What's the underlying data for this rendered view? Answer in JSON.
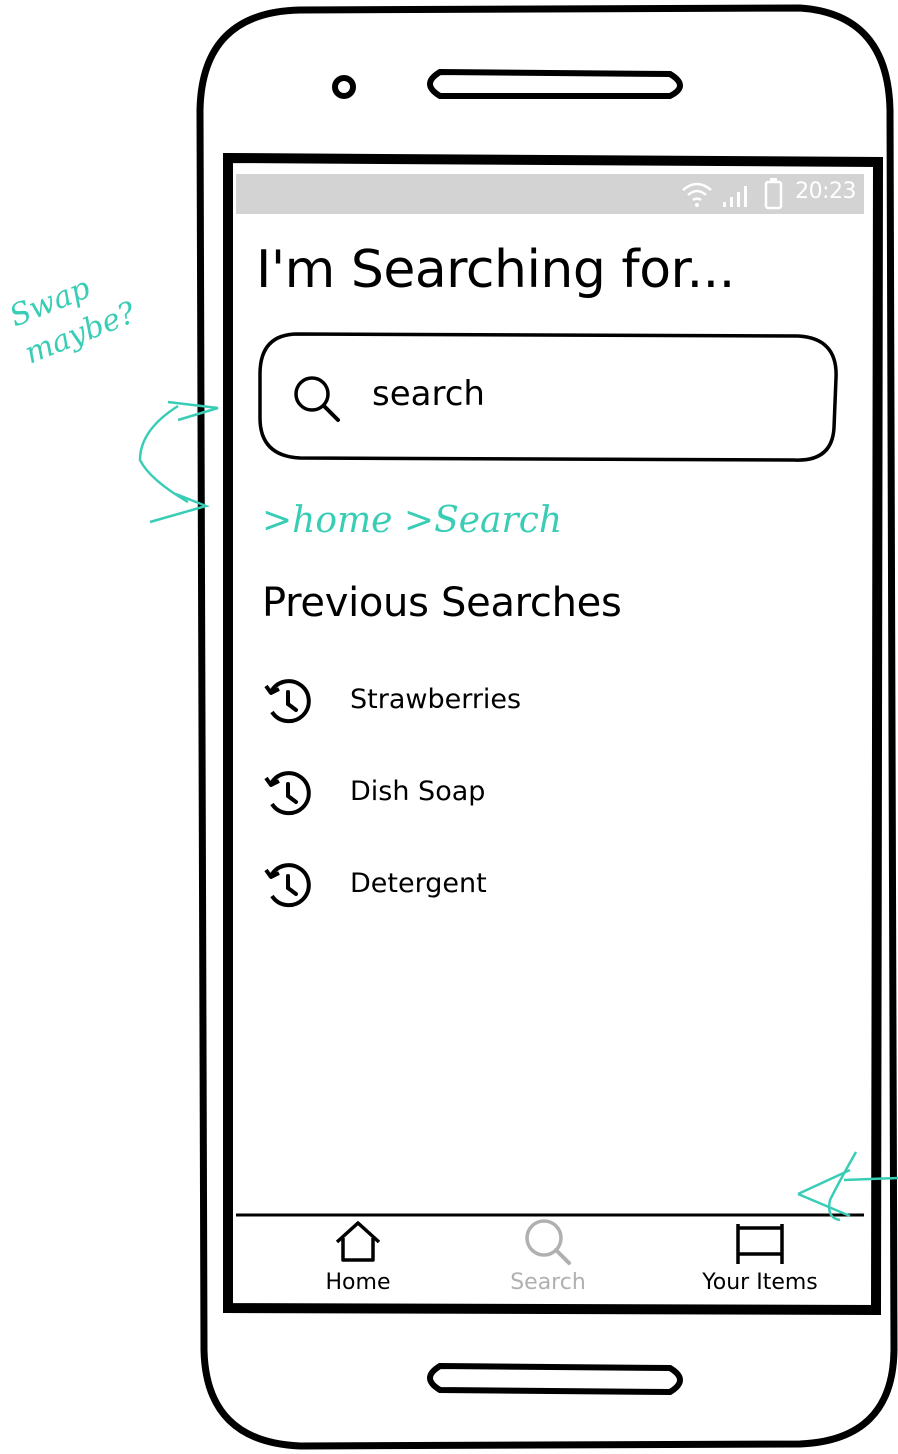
{
  "status_bar": {
    "time": "20:23"
  },
  "page_title": "I'm Searching for...",
  "search": {
    "placeholder": "search"
  },
  "annotations": {
    "swap_note": "Swap maybe?",
    "breadcrumb_note": ">home >Search"
  },
  "previous_searches": {
    "title": "Previous Searches",
    "items": [
      {
        "label": "Strawberries"
      },
      {
        "label": "Dish Soap"
      },
      {
        "label": "Detergent"
      }
    ]
  },
  "bottom_nav": {
    "items": [
      {
        "label": "Home",
        "icon": "home-icon",
        "state": "active"
      },
      {
        "label": "Search",
        "icon": "search-icon",
        "state": "disabled"
      },
      {
        "label": "Your Items",
        "icon": "bed-icon",
        "state": "active"
      }
    ]
  },
  "colors": {
    "status_bar": "#d3d3d3",
    "annotation": "#39cdb6",
    "disabled_text": "#b0b0b0"
  }
}
